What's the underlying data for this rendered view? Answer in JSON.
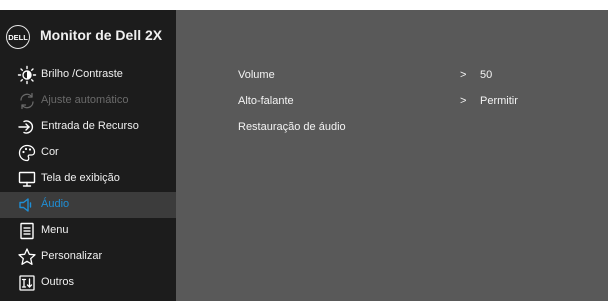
{
  "header": {
    "logo_text": "DELL",
    "title": "Monitor de Dell 2X"
  },
  "menu": [
    {
      "label": "Brilho /Contraste",
      "icon": "brightness-icon",
      "state": "normal"
    },
    {
      "label": "Ajuste automático",
      "icon": "auto-adjust-icon",
      "state": "disabled"
    },
    {
      "label": "Entrada de Recurso",
      "icon": "input-source-icon",
      "state": "normal"
    },
    {
      "label": "Cor",
      "icon": "color-icon",
      "state": "normal"
    },
    {
      "label": "Tela de exibição",
      "icon": "display-icon",
      "state": "normal"
    },
    {
      "label": "Áudio",
      "icon": "speaker-icon",
      "state": "selected"
    },
    {
      "label": "Menu",
      "icon": "menu-icon",
      "state": "normal"
    },
    {
      "label": "Personalizar",
      "icon": "star-icon",
      "state": "normal"
    },
    {
      "label": "Outros",
      "icon": "others-icon",
      "state": "normal"
    }
  ],
  "audio_options": [
    {
      "label": "Volume",
      "arrow": ">",
      "value": "50"
    },
    {
      "label": "Alto-falante",
      "arrow": ">",
      "value": "Permitir"
    },
    {
      "label": "Restauração de áudio"
    }
  ],
  "colors": {
    "sidebar_bg": "#1c1c1c",
    "main_bg": "#595959",
    "accent": "#1f8fd6",
    "disabled_text": "#6a6a6a"
  }
}
